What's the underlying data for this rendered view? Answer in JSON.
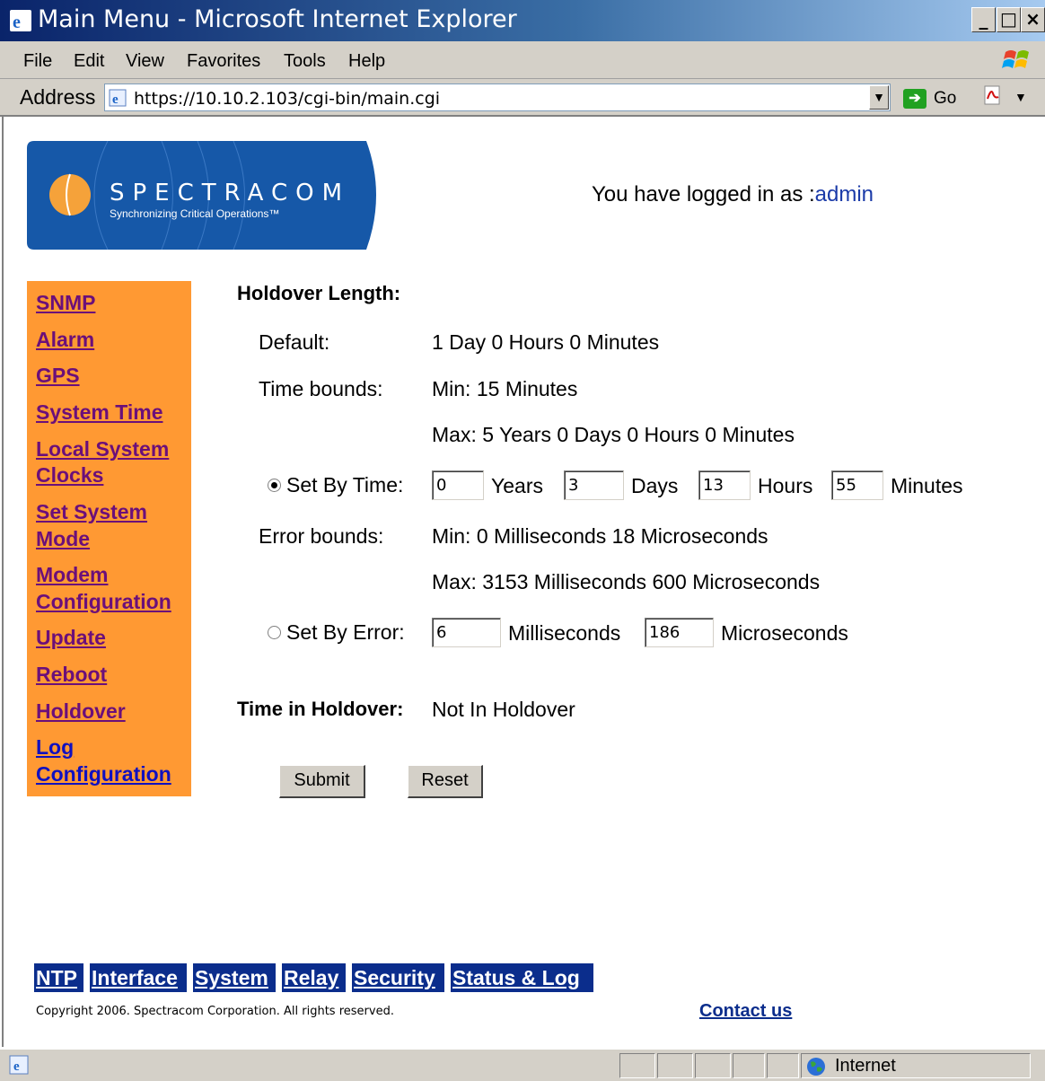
{
  "window": {
    "title": "Main Menu - Microsoft Internet Explorer",
    "minimize": "_",
    "maximize": "□",
    "close": "×"
  },
  "menu": [
    "File",
    "Edit",
    "View",
    "Favorites",
    "Tools",
    "Help"
  ],
  "address": {
    "label": "Address",
    "url": "https://10.10.2.103/cgi-bin/main.cgi",
    "go_label": "Go"
  },
  "header": {
    "logo_text": "SPECTRACOM",
    "logo_tagline": "Synchronizing Critical Operations™",
    "login_prefix": "You have logged in as :",
    "username": "admin"
  },
  "sidebar": {
    "items": [
      {
        "label": "SNMP"
      },
      {
        "label": "Alarm"
      },
      {
        "label": "GPS"
      },
      {
        "label": "System Time"
      },
      {
        "label": "Local System"
      },
      {
        "label": "Clocks"
      },
      {
        "label": "Set System"
      },
      {
        "label": "Mode"
      },
      {
        "label": "Modem"
      },
      {
        "label": "Configuration"
      },
      {
        "label": "Update"
      },
      {
        "label": "Reboot"
      },
      {
        "label": "Holdover"
      },
      {
        "label": "Log"
      },
      {
        "label": "Configuration"
      }
    ]
  },
  "holdover": {
    "title": "Holdover Length:",
    "default_label": "Default:",
    "default_value": "1 Day 0 Hours 0 Minutes",
    "time_bounds_label": "Time bounds:",
    "time_min": "Min: 15 Minutes",
    "time_max": "Max: 5 Years 0 Days 0 Hours 0 Minutes",
    "set_by_time_label": "Set By Time:",
    "set_by_time_selected": true,
    "years_value": "0",
    "years_unit": "Years",
    "days_value": "3",
    "days_unit": "Days",
    "hours_value": "13",
    "hours_unit": "Hours",
    "minutes_value": "55",
    "minutes_unit": "Minutes",
    "error_bounds_label": "Error bounds:",
    "error_min": "Min: 0 Milliseconds 18 Microseconds",
    "error_max": "Max: 3153 Milliseconds 600 Microseconds",
    "set_by_error_label": "Set By Error:",
    "set_by_error_selected": false,
    "ms_value": "6",
    "ms_unit": "Milliseconds",
    "us_value": "186",
    "us_unit": "Microseconds",
    "time_in_holdover_label": "Time in Holdover:",
    "time_in_holdover_value": "Not In Holdover",
    "submit_label": "Submit",
    "reset_label": "Reset"
  },
  "footer": {
    "tabs": [
      "NTP",
      "Interface",
      "System",
      "Relay",
      "Security",
      "Status & Log"
    ],
    "copyright": "Copyright 2006. Spectracom Corporation. All rights reserved.",
    "contact": "Contact us"
  },
  "status": {
    "zone": "Internet"
  },
  "colors": {
    "sidebar_bg": "#ff9933",
    "tab_bg": "#0b2d8c",
    "nav_link": "#6b0f7a"
  }
}
